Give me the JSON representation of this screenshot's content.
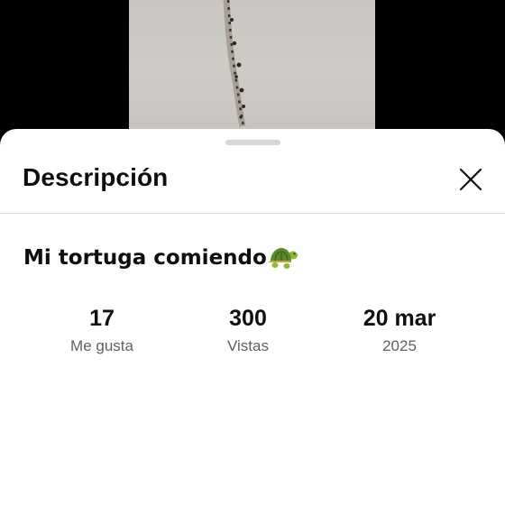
{
  "video": {
    "thumbnail_icon": "video-frame"
  },
  "sheet": {
    "title": "Descripción",
    "close_icon": "close-icon"
  },
  "description": {
    "video_title": "Mi tortuga comiendo",
    "title_emoji": "turtle-icon"
  },
  "stats": {
    "likes_value": "17",
    "likes_label": "Me gusta",
    "views_value": "300",
    "views_label": "Vistas",
    "date_value": "20 mar",
    "date_year": "2025"
  },
  "colors": {
    "text_primary": "#0f0f0f",
    "text_secondary": "#606060",
    "sheet_bg": "#ffffff",
    "backdrop": "#000000"
  }
}
